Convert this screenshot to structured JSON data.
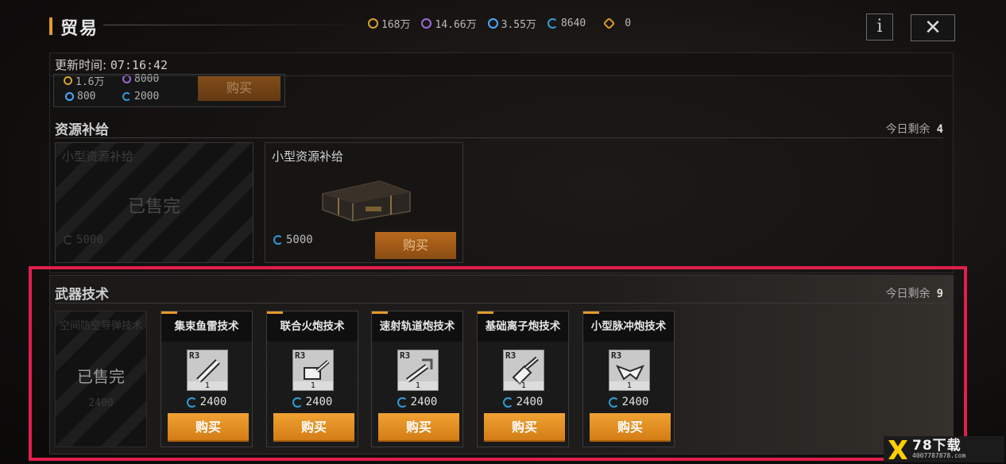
{
  "header": {
    "title": "贸易",
    "currencies": [
      {
        "icon": "gold-coin-icon",
        "value": "168万"
      },
      {
        "icon": "purple-crystal-icon",
        "value": "14.66万"
      },
      {
        "icon": "blue-energy-icon",
        "value": "3.55万"
      },
      {
        "icon": "cycle-credit-icon",
        "value": "8640"
      },
      {
        "icon": "hex-token-icon",
        "value": "0"
      }
    ],
    "info_label": "i",
    "close_label": "✕"
  },
  "update": {
    "label": "更新时间:",
    "time": "07:16:42"
  },
  "previous_card": {
    "prices": [
      "1.6万",
      "8000",
      "800",
      "2000"
    ],
    "buy_label": "购买"
  },
  "resource_section": {
    "title": "资源补给",
    "remaining_label": "今日剩余",
    "remaining": "4",
    "items": [
      {
        "name": "小型资源补给",
        "status": "已售完",
        "price": "5000",
        "sold": true
      },
      {
        "name": "小型资源补给",
        "price": "5000",
        "buy_label": "购买",
        "sold": false
      }
    ]
  },
  "weapon_section": {
    "title": "武器技术",
    "remaining_label": "今日剩余",
    "remaining": "9",
    "sold_item": {
      "name": "空间防空导弹技术",
      "status": "已售完",
      "price": "2400"
    },
    "items": [
      {
        "name": "集束鱼雷技术",
        "rank": "R3",
        "level": "1",
        "price": "2400",
        "buy_label": "购买"
      },
      {
        "name": "联合火炮技术",
        "rank": "R3",
        "level": "1",
        "price": "2400",
        "buy_label": "购买"
      },
      {
        "name": "速射轨道炮技术",
        "rank": "R3",
        "level": "1",
        "price": "2400",
        "buy_label": "购买"
      },
      {
        "name": "基础离子炮技术",
        "rank": "R3",
        "level": "1",
        "price": "2400",
        "buy_label": "购买"
      },
      {
        "name": "小型脉冲炮技术",
        "rank": "R3",
        "level": "1",
        "price": "2400",
        "buy_label": "购买"
      }
    ]
  },
  "watermark": {
    "big": "78下载",
    "small": "4007787878.com"
  },
  "colors": {
    "accent": "#e39a2a",
    "highlight": "#e21e4d",
    "buy": "#e38a1e"
  }
}
